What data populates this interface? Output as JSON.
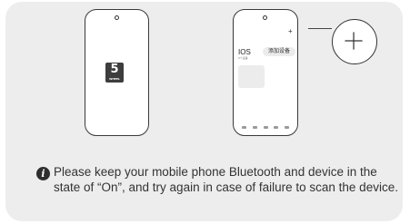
{
  "left_phone": {
    "logo_digit": "5",
    "logo_text": "WHEEL"
  },
  "right_phone": {
    "title": "IOS",
    "subtitle": "0个设备",
    "add_device_label": "添加设备",
    "small_plus": "+",
    "nav_items": 5
  },
  "zoom_icon": "plus-icon",
  "notice": {
    "icon": "info-icon",
    "text": "Please keep your mobile phone Bluetooth and device in the state of “On”, and try again in case of failure to scan the device."
  },
  "colors": {
    "card_background": "#ededed",
    "outline": "#333333",
    "text": "#333333"
  }
}
